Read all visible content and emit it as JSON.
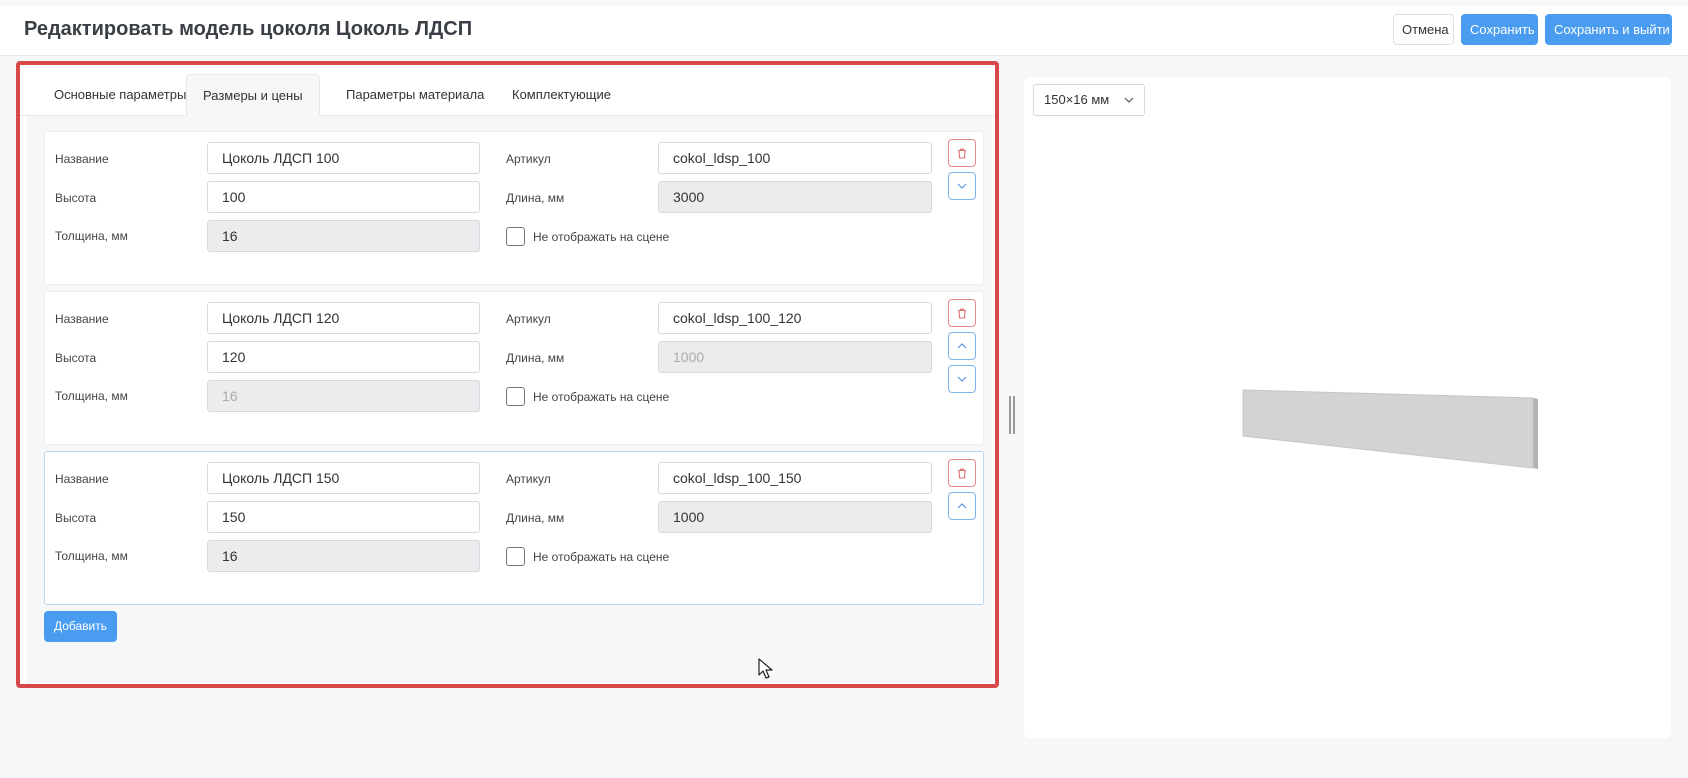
{
  "header": {
    "title": "Редактировать модель цоколя Цоколь ЛДСП",
    "cancel_label": "Отмена",
    "save_label": "Сохранить",
    "save_exit_label": "Сохранить и выйти"
  },
  "tabs": [
    {
      "label": "Основные параметры",
      "active": false
    },
    {
      "label": "Размеры и цены",
      "active": true
    },
    {
      "label": "Параметры материала",
      "active": false
    },
    {
      "label": "Комплектующие",
      "active": false
    }
  ],
  "labels": {
    "name": "Название",
    "height": "Высота",
    "thickness": "Толщина, мм",
    "article": "Артикул",
    "length": "Длина, мм",
    "hide_on_scene": "Не отображать на сцене"
  },
  "variants": [
    {
      "name": "Цоколь ЛДСП 100",
      "height": "100",
      "thickness": "16",
      "article": "cokol_ldsp_100",
      "length": "3000",
      "hide_on_scene": false
    },
    {
      "name": "Цоколь ЛДСП 120",
      "height": "120",
      "thickness": "16",
      "article": "cokol_ldsp_100_120",
      "length": "1000",
      "hide_on_scene": false
    },
    {
      "name": "Цоколь ЛДСП 150",
      "height": "150",
      "thickness": "16",
      "article": "cokol_ldsp_100_150",
      "length": "1000",
      "hide_on_scene": false
    }
  ],
  "icons": {
    "delete": "trash-icon",
    "up": "chevron-up-icon",
    "down": "chevron-down-icon"
  },
  "add_label": "Добавить",
  "preview": {
    "size_value": "150×16 мм"
  },
  "colors": {
    "accent": "#4a9cf0",
    "danger": "#d94848"
  }
}
